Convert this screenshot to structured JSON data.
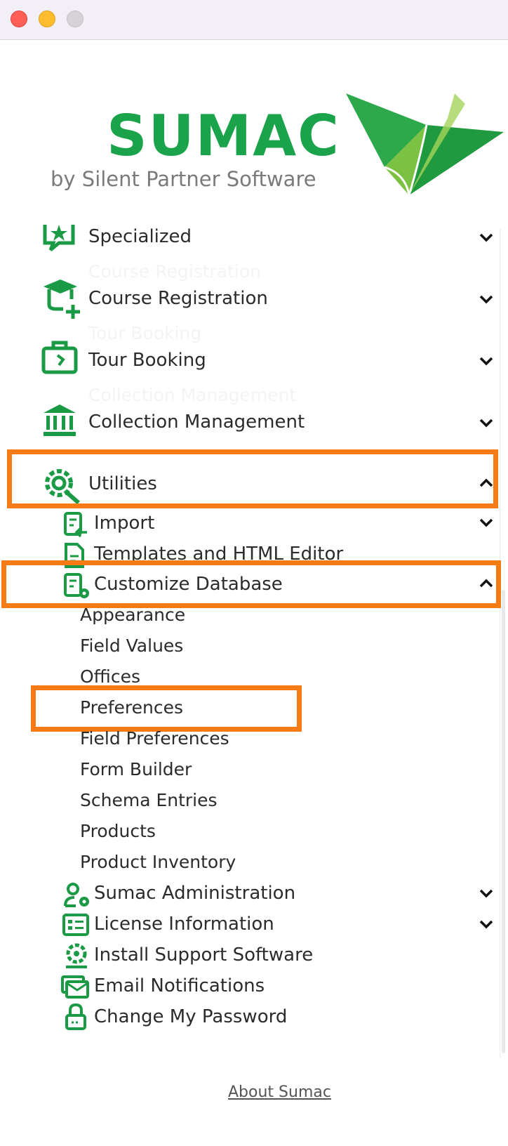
{
  "window": {
    "controls": [
      "close",
      "minimize",
      "zoom"
    ]
  },
  "brand": {
    "name": "SUMAC",
    "tagline": "by Silent Partner Software",
    "colors": {
      "green": "#1aa34a",
      "highlight": "#f77b14"
    }
  },
  "menu": {
    "specialized": "Specialized",
    "course_registration": "Course Registration",
    "tour_booking": "Tour Booking",
    "collection_management": "Collection Management",
    "utilities": "Utilities",
    "ghost_course": "Course Registration",
    "ghost_tour": "Tour Booking",
    "ghost_collection": "Collection Management"
  },
  "utilities": {
    "import": "Import",
    "templates": "Templates and HTML Editor",
    "customize_database": "Customize Database",
    "customize_items": [
      "Appearance",
      "Field Values",
      "Offices",
      "Preferences",
      "Field Preferences",
      "Form Builder",
      "Schema Entries",
      "Products",
      "Product Inventory"
    ],
    "sumac_administration": "Sumac Administration",
    "license_information": "License Information",
    "install_support": "Install Support Software",
    "email_notifications": "Email Notifications",
    "change_password": "Change My Password"
  },
  "footer": {
    "about": "About Sumac"
  }
}
